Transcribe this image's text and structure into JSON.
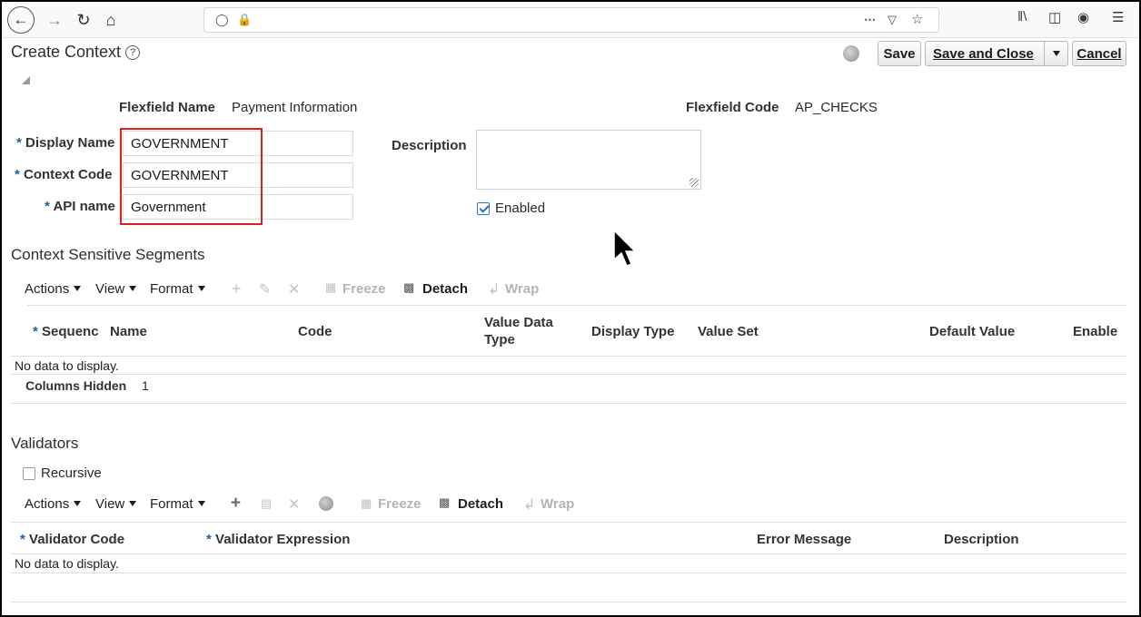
{
  "page": {
    "title": "Create Context",
    "toolbar": {
      "save": "Save",
      "save_and_close": "Save and Close",
      "cancel": "Cancel"
    }
  },
  "form": {
    "flexfield_name_label": "Flexfield Name",
    "flexfield_name_value": "Payment Information",
    "flexfield_code_label": "Flexfield Code",
    "flexfield_code_value": "AP_CHECKS",
    "display_name_label": "Display Name",
    "display_name_value": "GOVERNMENT",
    "context_code_label": "Context Code",
    "context_code_value": "GOVERNMENT",
    "api_name_label": "API name",
    "api_name_value": "Government",
    "description_label": "Description",
    "description_value": "",
    "enabled_label": "Enabled",
    "enabled_checked": true
  },
  "segments": {
    "title": "Context Sensitive Segments",
    "toolbar": {
      "actions": "Actions",
      "view": "View",
      "format": "Format",
      "freeze": "Freeze",
      "detach": "Detach",
      "wrap": "Wrap"
    },
    "columns": [
      "Sequenc",
      "Name",
      "Code",
      "Value Data",
      "Type",
      "Display Type",
      "Value Set",
      "Default Value",
      "Enable"
    ],
    "no_data": "No data to display.",
    "columns_hidden_label": "Columns Hidden",
    "columns_hidden_count": "1"
  },
  "validators": {
    "title": "Validators",
    "recursive_label": "Recursive",
    "recursive_checked": false,
    "toolbar": {
      "actions": "Actions",
      "view": "View",
      "format": "Format",
      "freeze": "Freeze",
      "detach": "Detach",
      "wrap": "Wrap"
    },
    "columns": [
      "Validator Code",
      "Validator Expression",
      "Error Message",
      "Description"
    ],
    "no_data": "No data to display."
  },
  "icons": {
    "back": "back-arrow-icon",
    "forward": "forward-arrow-icon",
    "reload": "reload-icon",
    "home": "home-icon",
    "shield": "tracking-shield-icon",
    "lock": "lock-icon",
    "more": "more-icon",
    "pocket": "pocket-icon",
    "star": "bookmark-star-icon",
    "library": "library-icon",
    "sidebar": "sidebar-icon",
    "account": "account-icon",
    "menu": "hamburger-menu-icon"
  },
  "colors": {
    "required_asterisk": "#1a5fb4",
    "highlight_box": "#e02020",
    "checkbox_blue": "#2a6fc9"
  }
}
